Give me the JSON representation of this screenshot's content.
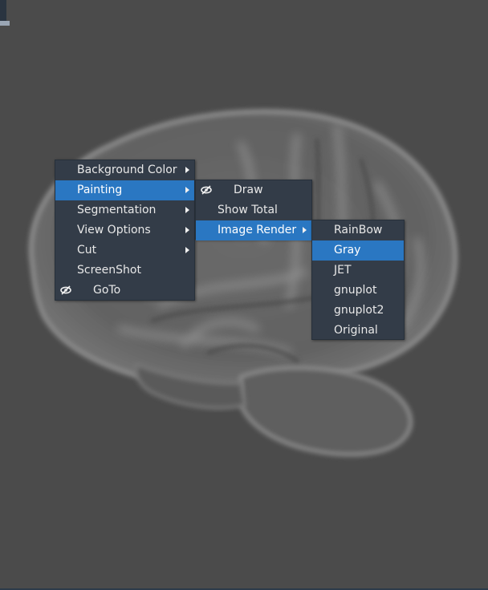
{
  "context_menu": {
    "items": [
      {
        "label": "Background Color",
        "submenu": true
      },
      {
        "label": "Painting",
        "submenu": true,
        "selected": true
      },
      {
        "label": "Segmentation",
        "submenu": true
      },
      {
        "label": "View Options",
        "submenu": true
      },
      {
        "label": "Cut",
        "submenu": true
      },
      {
        "label": "ScreenShot",
        "submenu": false
      },
      {
        "label": "GoTo",
        "submenu": false,
        "icon": "hidden-eye-icon"
      }
    ]
  },
  "painting_menu": {
    "items": [
      {
        "label": "Draw",
        "icon": "hidden-eye-icon"
      },
      {
        "label": "Show Total"
      },
      {
        "label": "Image Render",
        "submenu": true,
        "selected": true
      }
    ]
  },
  "render_menu": {
    "items": [
      {
        "label": "RainBow"
      },
      {
        "label": "Gray",
        "selected": true
      },
      {
        "label": "JET"
      },
      {
        "label": "gnuplot"
      },
      {
        "label": "gnuplot2"
      },
      {
        "label": "Original"
      }
    ]
  },
  "colors": {
    "background": "#4b4b4b",
    "menu_bg": "#333c48",
    "highlight": "#2a77c2"
  }
}
